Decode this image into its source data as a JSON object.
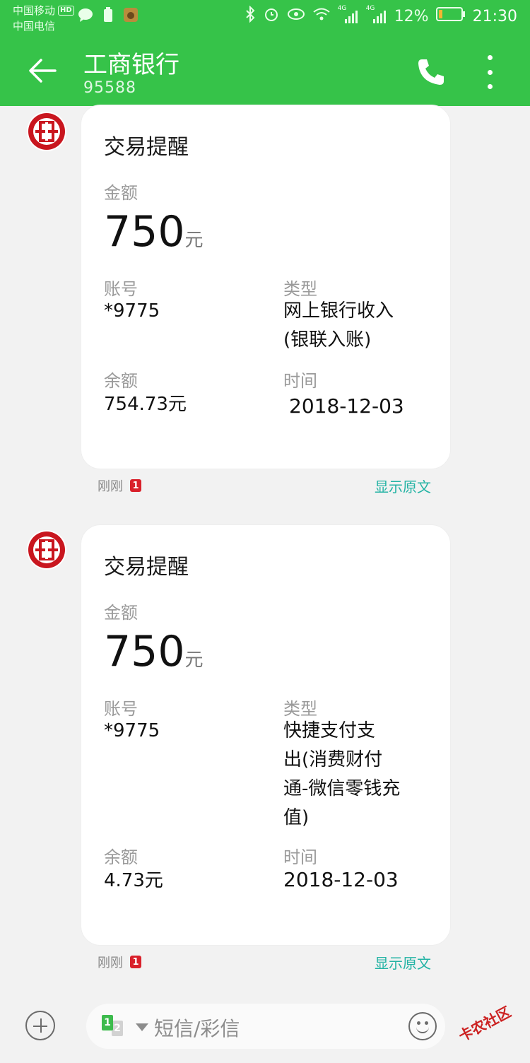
{
  "status_bar": {
    "carrier_1": "中国移动",
    "hd_badge": "HD",
    "carrier_2": "中国电信",
    "signal_tag_1": "4G",
    "signal_tag_2": "4G",
    "battery": "12%",
    "time": "21:30"
  },
  "header": {
    "title": "工商银行",
    "number": "95588"
  },
  "messages": [
    {
      "title": "交易提醒",
      "amount_label": "金额",
      "amount": "750",
      "amount_unit": "元",
      "account_label": "账号",
      "account": "*9775",
      "type_label": "类型",
      "type_line1": "网上银行收入",
      "type_line2": "(银联入账)",
      "balance_label": "余额",
      "balance": "754.73元",
      "time_label": "时间",
      "date": "2018-12-03",
      "received": "刚刚",
      "sim_badge": "1",
      "show_original": "显示原文"
    },
    {
      "title": "交易提醒",
      "amount_label": "金额",
      "amount": "750",
      "amount_unit": "元",
      "account_label": "账号",
      "account": "*9775",
      "type_label": "类型",
      "type_line1": "快捷支付支",
      "type_line2": "出(消费财付",
      "type_line3": "通-微信零钱充",
      "type_line4": "值)",
      "balance_label": "余额",
      "balance": "4.73元",
      "time_label": "时间",
      "date": "2018-12-03",
      "received": "刚刚",
      "sim_badge": "1",
      "show_original": "显示原文"
    }
  ],
  "composer": {
    "sim1": "1",
    "sim2": "2",
    "placeholder": "短信/彩信"
  },
  "watermark": "卡农社区",
  "colors": {
    "header_green": "#36c349",
    "link_teal": "#23b3a4",
    "badge_red": "#d9212b",
    "bank_logo_red": "#c9161f"
  }
}
